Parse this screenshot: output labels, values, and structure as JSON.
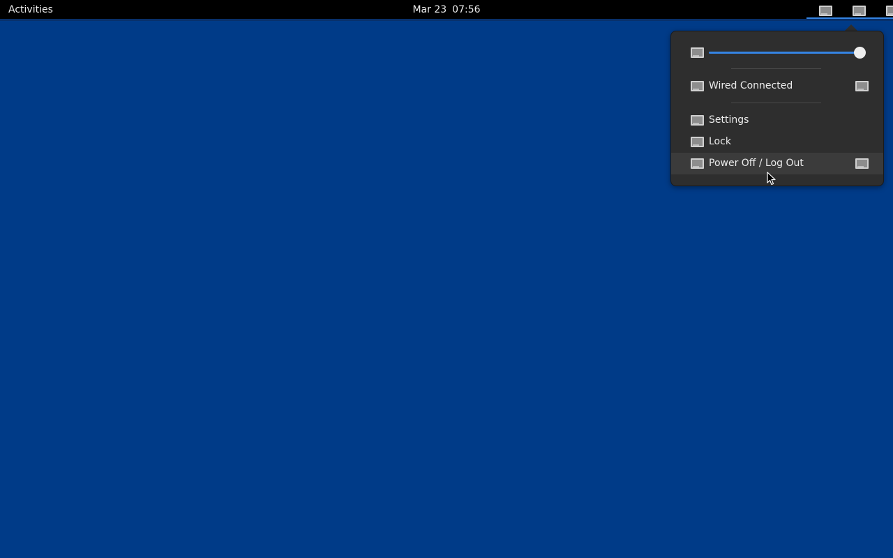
{
  "top_bar": {
    "activities_label": "Activities",
    "date": "Mar 23",
    "time": "07:56",
    "tray_icons": [
      "network-icon",
      "volume-icon",
      "battery-icon",
      "power-menu-icon"
    ]
  },
  "system_menu": {
    "volume": {
      "icon": "volume-icon",
      "level": 1.0
    },
    "network": {
      "icon": "network-wired-icon",
      "label": "Wired Connected",
      "expand_icon": "expand-icon"
    },
    "items": [
      {
        "icon": "settings-icon",
        "label": "Settings"
      },
      {
        "icon": "lock-icon",
        "label": "Lock"
      },
      {
        "icon": "power-icon",
        "label": "Power Off / Log Out",
        "expand_icon": "expand-icon",
        "hovered": true
      }
    ]
  },
  "colors": {
    "desktop_background": "#003b88",
    "top_bar": "#000000",
    "menu_background": "#2e2e2e",
    "accent": "#3584e4"
  }
}
